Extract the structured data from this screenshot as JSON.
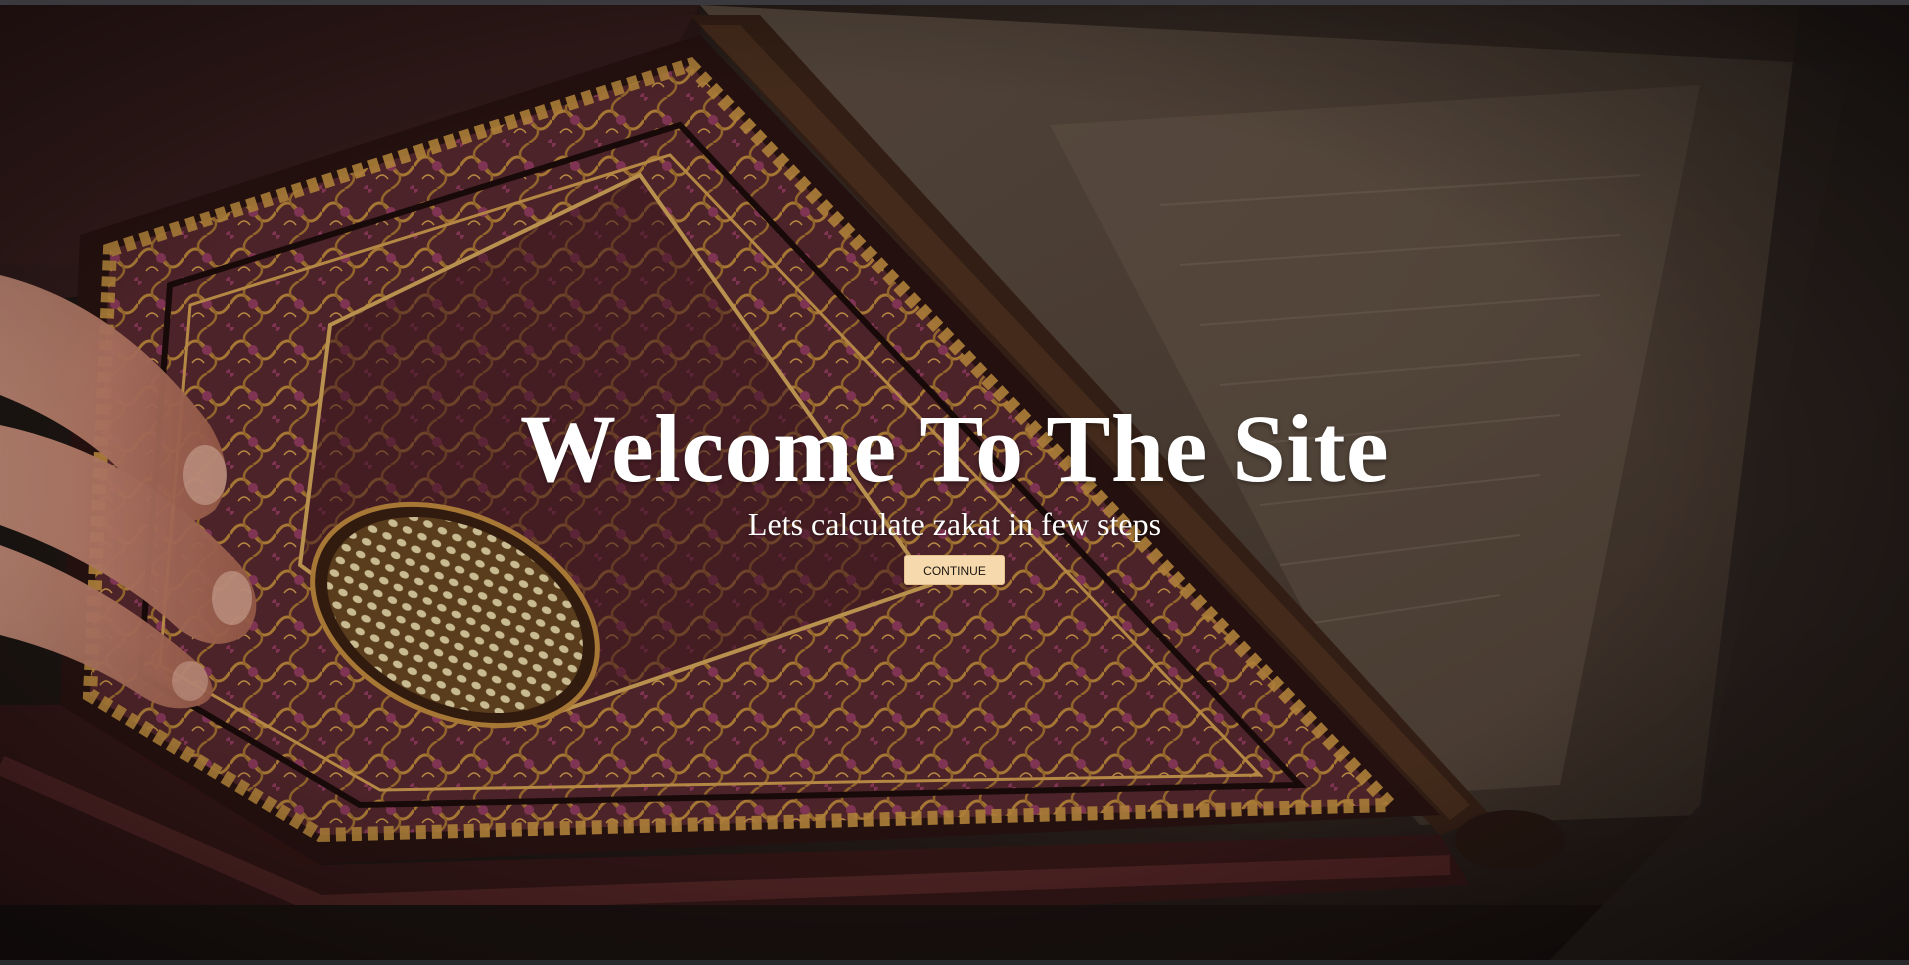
{
  "hero": {
    "title": "Welcome To The Site",
    "subtitle": "Lets calculate zakat in few steps",
    "continue_label": "CONTINUE",
    "background_image": "quran-ornate-cover"
  },
  "colors": {
    "button_background": "#f6d9ac",
    "title_text": "#ffffff",
    "cover_gold": "#b8873c",
    "cover_magenta": "#8a3a5a"
  }
}
